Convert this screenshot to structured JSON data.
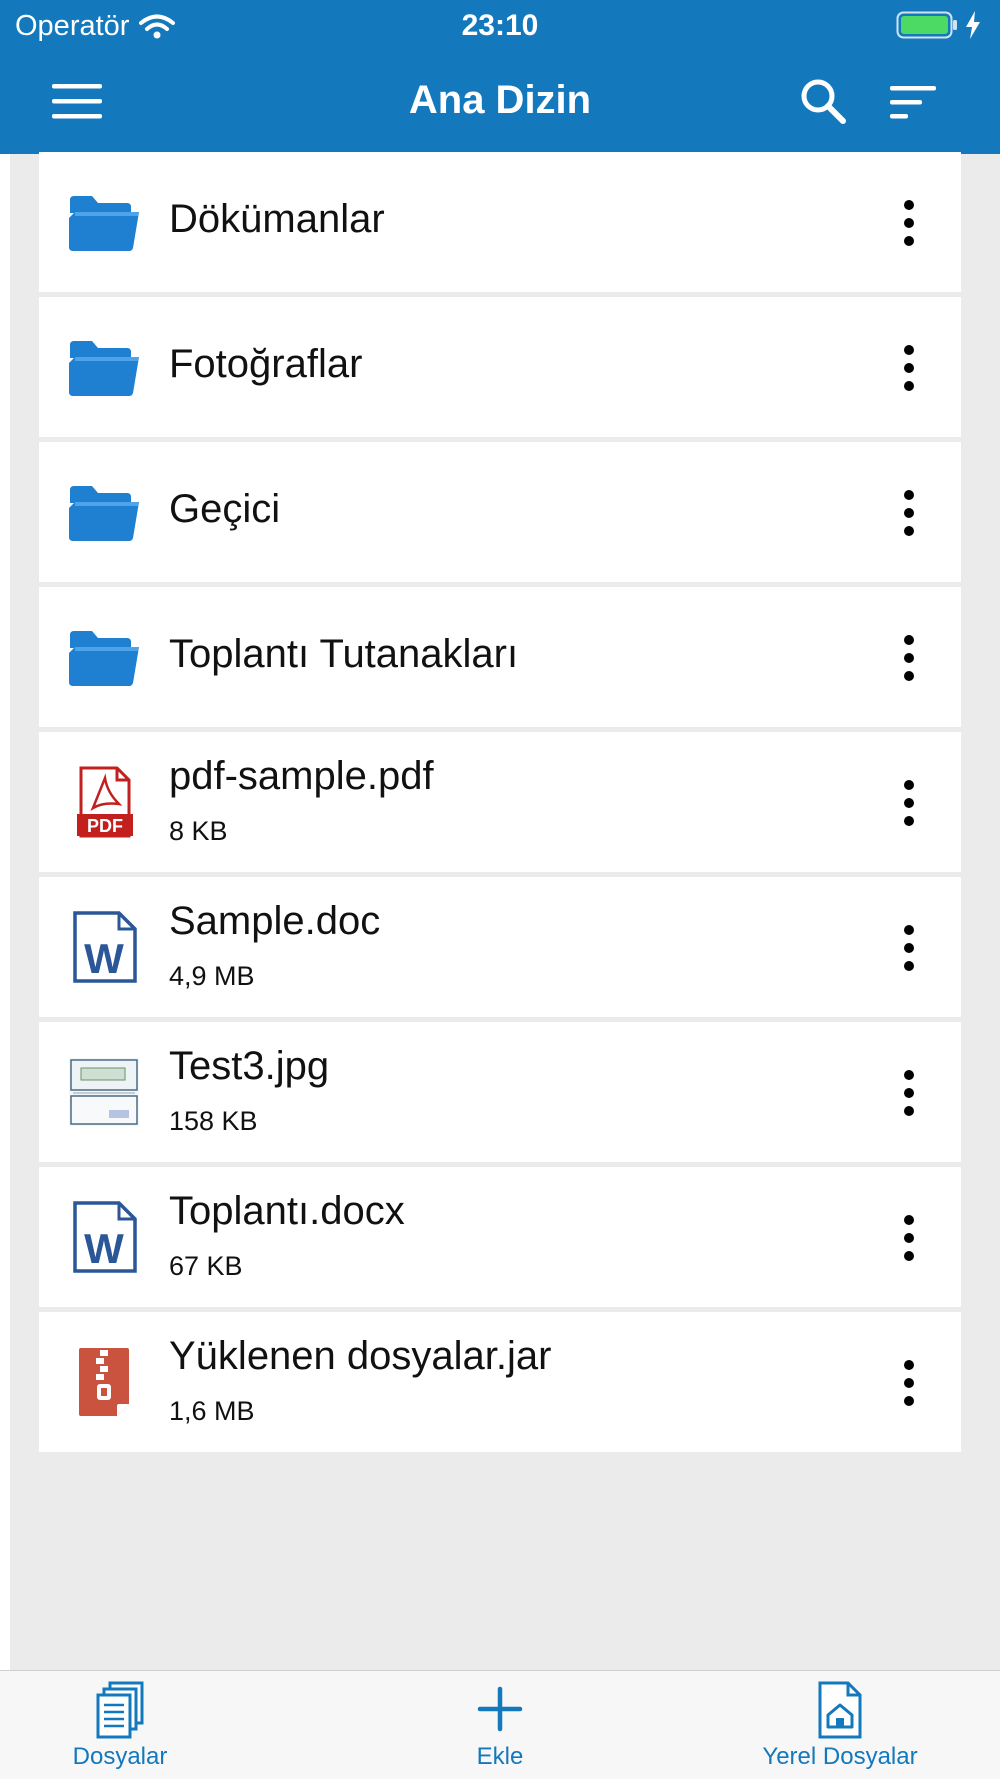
{
  "status_bar": {
    "carrier": "Operatör",
    "time": "23:10"
  },
  "header": {
    "title": "Ana Dizin"
  },
  "icons": {
    "menu": "hamburger-icon",
    "search": "search-icon",
    "sort": "sort-icon",
    "more": "more-vertical-icon"
  },
  "colors": {
    "brand": "#1378BC",
    "folder": "#1F7FD0",
    "pdf": "#C1201F",
    "word": "#2B5798",
    "zip": "#C9533E"
  },
  "files": [
    {
      "name": "Dökümanlar",
      "size": "",
      "type": "folder"
    },
    {
      "name": "Fotoğraflar",
      "size": "",
      "type": "folder"
    },
    {
      "name": "Geçici",
      "size": "",
      "type": "folder"
    },
    {
      "name": "Toplantı Tutanakları",
      "size": "",
      "type": "folder"
    },
    {
      "name": "pdf-sample.pdf",
      "size": "8 KB",
      "type": "pdf"
    },
    {
      "name": "Sample.doc",
      "size": "4,9 MB",
      "type": "word"
    },
    {
      "name": "Test3.jpg",
      "size": "158 KB",
      "type": "image"
    },
    {
      "name": "Toplantı.docx",
      "size": "67 KB",
      "type": "word"
    },
    {
      "name": "Yüklenen dosyalar.jar",
      "size": "1,6 MB",
      "type": "zip"
    }
  ],
  "tabbar": {
    "files_label": "Dosyalar",
    "add_label": "Ekle",
    "local_label": "Yerel Dosyalar"
  }
}
